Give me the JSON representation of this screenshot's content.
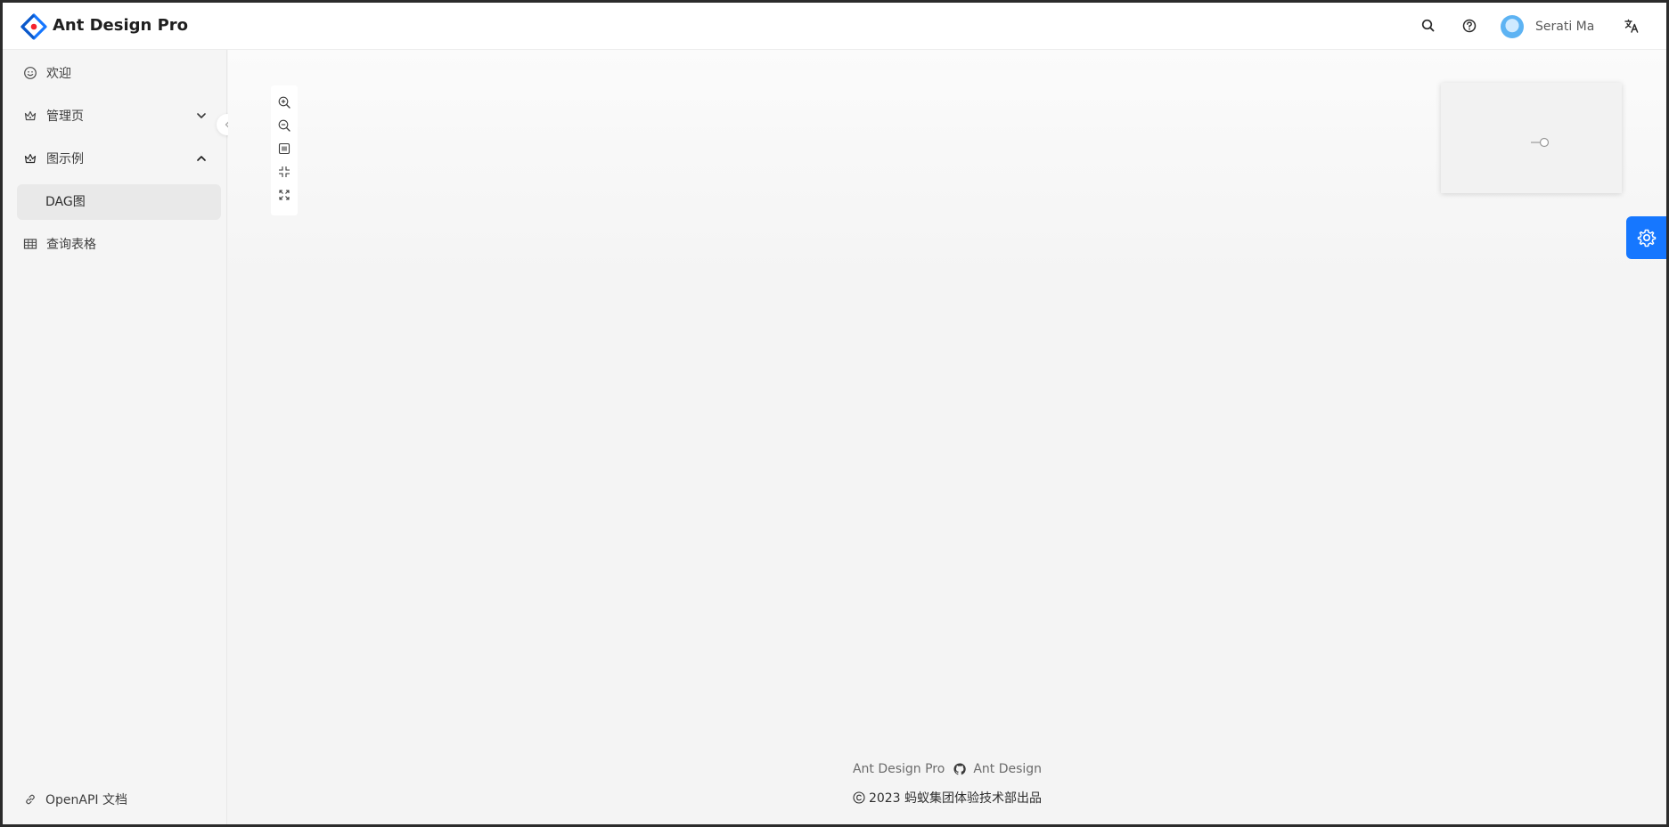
{
  "header": {
    "brand": "Ant Design Pro",
    "user_name": "Serati Ma",
    "icons": [
      "search-icon",
      "question-circle-icon",
      "translation-icon"
    ]
  },
  "sidebar": {
    "items": [
      {
        "label": "欢迎",
        "icon": "smile-icon"
      },
      {
        "label": "管理页",
        "icon": "crown-icon",
        "expanded": false
      },
      {
        "label": "图示例",
        "icon": "crown-icon",
        "expanded": true,
        "children": [
          {
            "label": "DAG图",
            "selected": true
          }
        ]
      },
      {
        "label": "查询表格",
        "icon": "table-icon"
      }
    ],
    "footer_link": "OpenAPI 文档"
  },
  "graph_toolbar": {
    "buttons": [
      "zoom-in-icon",
      "zoom-out-icon",
      "fit-view-icon",
      "compress-icon",
      "fullscreen-icon"
    ]
  },
  "footer": {
    "links": [
      "Ant Design Pro",
      "Ant Design"
    ],
    "copyright": "2023 蚂蚁集团体验技术部出品"
  },
  "colors": {
    "primary": "#1677ff",
    "logo_blue": "#1677ff",
    "logo_red": "#f5222d"
  }
}
